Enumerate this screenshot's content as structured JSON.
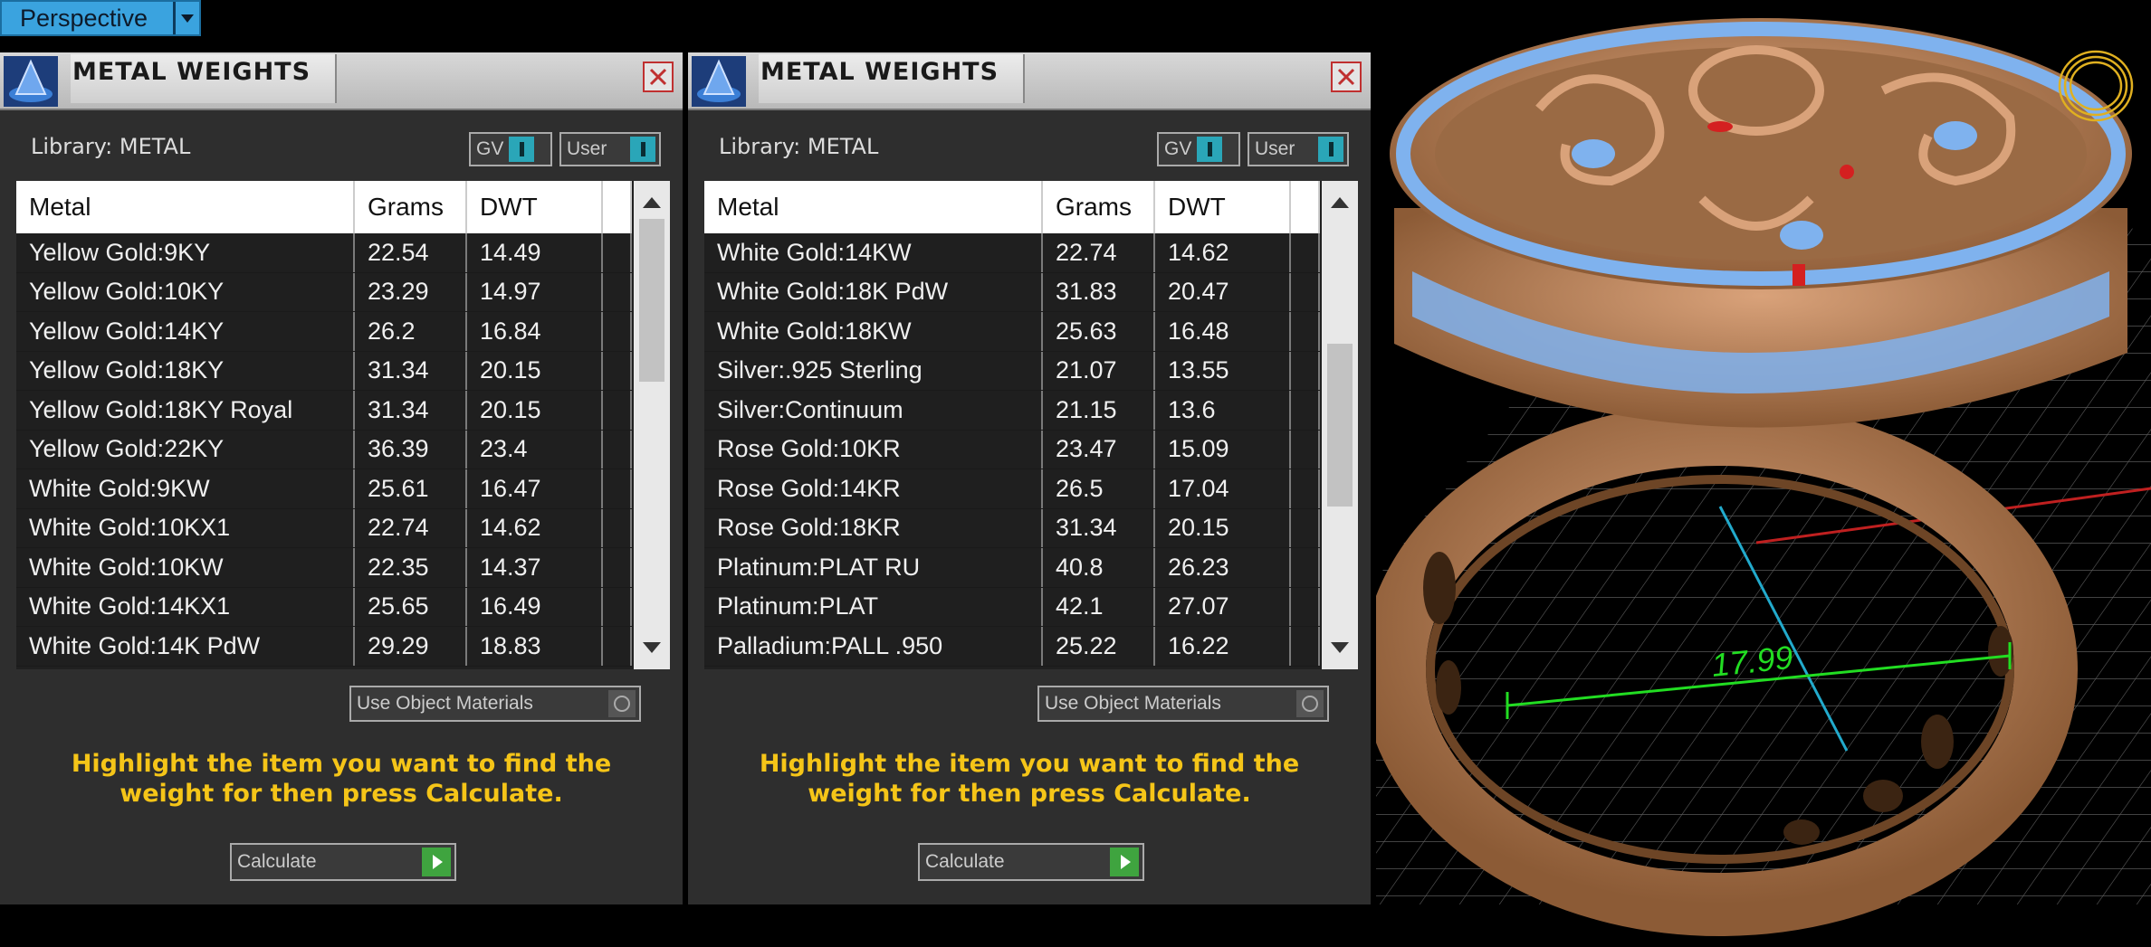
{
  "viewport": {
    "label": "Perspective",
    "dimension": "17.99"
  },
  "panels": [
    {
      "title": "METAL WEIGHTS",
      "library_label": "Library: METAL",
      "toggle_gv": "GV",
      "toggle_user": "User",
      "columns": [
        "Metal",
        "Grams",
        "DWT"
      ],
      "rows": [
        [
          "Yellow Gold:9KY",
          "22.54",
          "14.49"
        ],
        [
          "Yellow Gold:10KY",
          "23.29",
          "14.97"
        ],
        [
          "Yellow Gold:14KY",
          "26.2",
          "16.84"
        ],
        [
          "Yellow Gold:18KY",
          "31.34",
          "20.15"
        ],
        [
          "Yellow Gold:18KY Royal",
          "31.34",
          "20.15"
        ],
        [
          "Yellow Gold:22KY",
          "36.39",
          "23.4"
        ],
        [
          "White Gold:9KW",
          "25.61",
          "16.47"
        ],
        [
          "White Gold:10KX1",
          "22.74",
          "14.62"
        ],
        [
          "White Gold:10KW",
          "22.35",
          "14.37"
        ],
        [
          "White Gold:14KX1",
          "25.65",
          "16.49"
        ],
        [
          "White Gold:14K PdW",
          "29.29",
          "18.83"
        ]
      ],
      "scroll_position": 0.0,
      "use_object_materials": "Use Object Materials",
      "hint": "Highlight the item you want to find the weight for then press Calculate.",
      "calculate_label": "Calculate"
    },
    {
      "title": "METAL WEIGHTS",
      "library_label": "Library: METAL",
      "toggle_gv": "GV",
      "toggle_user": "User",
      "columns": [
        "Metal",
        "Grams",
        "DWT"
      ],
      "rows": [
        [
          "White Gold:14KW",
          "22.74",
          "14.62"
        ],
        [
          "White Gold:18K PdW",
          "31.83",
          "20.47"
        ],
        [
          "White Gold:18KW",
          "25.63",
          "16.48"
        ],
        [
          "Silver:.925 Sterling",
          "21.07",
          "13.55"
        ],
        [
          "Silver:Continuum",
          "21.15",
          "13.6"
        ],
        [
          "Rose Gold:10KR",
          "23.47",
          "15.09"
        ],
        [
          "Rose Gold:14KR",
          "26.5",
          "17.04"
        ],
        [
          "Rose Gold:18KR",
          "31.34",
          "20.15"
        ],
        [
          "Platinum:PLAT RU",
          "40.8",
          "26.23"
        ],
        [
          "Platinum:PLAT",
          "42.1",
          "27.07"
        ],
        [
          "Palladium:PALL .950",
          "25.22",
          "16.22"
        ]
      ],
      "scroll_position": 0.5,
      "use_object_materials": "Use Object Materials",
      "hint": "Highlight the item you want to find the weight for then press Calculate.",
      "calculate_label": "Calculate"
    }
  ],
  "colors": {
    "panel_bg": "#2e2e2e",
    "hint_text": "#f5c518",
    "toggle_on": "#2aa6b8",
    "calculate_go": "#3fa43f",
    "ring_metal": "#b9825a",
    "gem_blue": "#7fb2ee",
    "dimension_line": "#22dd22"
  }
}
